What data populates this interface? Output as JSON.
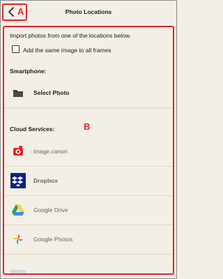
{
  "header": {
    "title": "Photo Locations",
    "annotation_a": "A"
  },
  "main": {
    "intro": "Import photos from one of the locations below.",
    "checkbox_label": "Add the same image to all frames",
    "checkbox_checked": false,
    "annotation_b": "B",
    "smartphone": {
      "heading": "Smartphone:",
      "items": [
        {
          "label": "Select Photo",
          "icon": "folder-icon"
        }
      ]
    },
    "cloud": {
      "heading": "Cloud Services:",
      "items": [
        {
          "label": "image.canon",
          "icon": "image-canon-icon"
        },
        {
          "label": "Dropbox",
          "icon": "dropbox-icon"
        },
        {
          "label": "Google Drive",
          "icon": "google-drive-icon"
        },
        {
          "label": "Google Photos",
          "icon": "google-photos-icon"
        }
      ]
    }
  },
  "colors": {
    "annotation": "#e0262b",
    "background": "#f3efe6",
    "dropbox": "#0d2481"
  }
}
